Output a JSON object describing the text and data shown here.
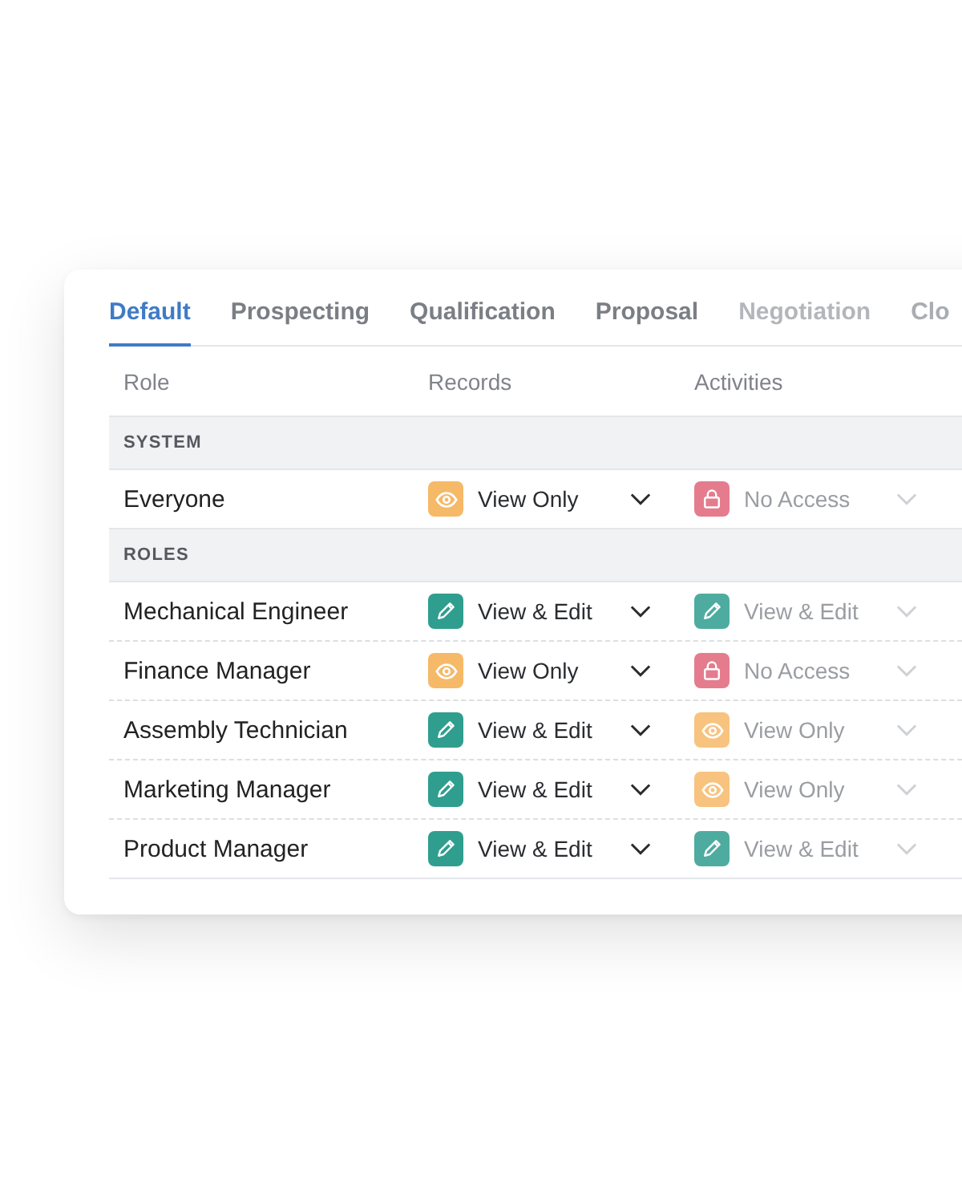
{
  "tabs": [
    {
      "label": "Default",
      "selected": true
    },
    {
      "label": "Prospecting",
      "selected": false
    },
    {
      "label": "Qualification",
      "selected": false
    },
    {
      "label": "Proposal",
      "selected": false
    },
    {
      "label": "Negotiation",
      "selected": false
    },
    {
      "label": "Clo",
      "selected": false
    }
  ],
  "columns": [
    "Role",
    "Records",
    "Activities"
  ],
  "sections": [
    {
      "title": "SYSTEM",
      "rows": [
        {
          "role": "Everyone",
          "records": {
            "kind": "view",
            "label": "View Only"
          },
          "activities": {
            "kind": "none",
            "label": "No Access"
          }
        }
      ]
    },
    {
      "title": "ROLES",
      "rows": [
        {
          "role": "Mechanical Engineer",
          "records": {
            "kind": "edit",
            "label": "View & Edit"
          },
          "activities": {
            "kind": "edit",
            "label": "View & Edit"
          }
        },
        {
          "role": "Finance Manager",
          "records": {
            "kind": "view",
            "label": "View Only"
          },
          "activities": {
            "kind": "none",
            "label": "No Access"
          }
        },
        {
          "role": "Assembly Technician",
          "records": {
            "kind": "edit",
            "label": "View & Edit"
          },
          "activities": {
            "kind": "view",
            "label": "View Only"
          }
        },
        {
          "role": "Marketing Manager",
          "records": {
            "kind": "edit",
            "label": "View & Edit"
          },
          "activities": {
            "kind": "view",
            "label": "View Only"
          }
        },
        {
          "role": "Product Manager",
          "records": {
            "kind": "edit",
            "label": "View & Edit"
          },
          "activities": {
            "kind": "edit",
            "label": "View & Edit"
          }
        }
      ]
    }
  ]
}
